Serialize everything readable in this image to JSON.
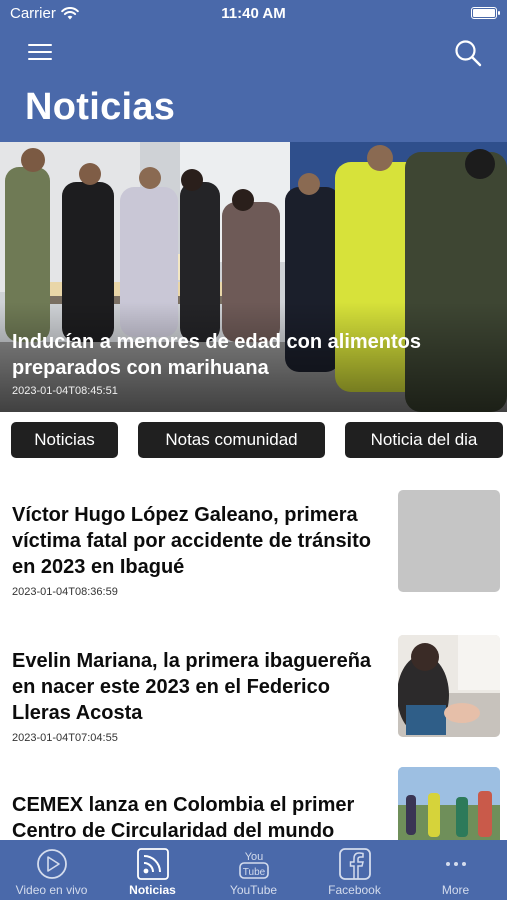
{
  "status_bar": {
    "carrier": "Carrier",
    "time": "11:40 AM"
  },
  "header": {
    "title": "Noticias",
    "menu_icon": "hamburger-menu-icon",
    "search_icon": "search-icon"
  },
  "hero": {
    "title": "Inducían a menores de edad con alimentos preparados con marihuana",
    "date": "2023-01-04T08:45:51"
  },
  "categories": [
    "Noticias",
    "Notas comunidad",
    "Noticia del dia"
  ],
  "articles": [
    {
      "title": "Víctor Hugo López Galeano, primera víctima fatal por accidente de tránsito en 2023 en Ibagué",
      "date": "2023-01-04T08:36:59"
    },
    {
      "title": "Evelin Mariana, la primera ibaguereña en nacer este 2023 en el Federico Lleras Acosta",
      "date": "2023-01-04T07:04:55"
    },
    {
      "title": "CEMEX lanza en Colombia el primer Centro de Circularidad del mundo",
      "date": ""
    }
  ],
  "tabbar": {
    "items": [
      {
        "label": "Video en vivo",
        "icon": "play-circle-icon"
      },
      {
        "label": "Noticias",
        "icon": "rss-feed-icon"
      },
      {
        "label": "YouTube",
        "icon": "youtube-icon"
      },
      {
        "label": "Facebook",
        "icon": "facebook-icon"
      },
      {
        "label": "More",
        "icon": "more-dots-icon"
      }
    ],
    "active": "Noticias"
  },
  "colors": {
    "brand_blue": "#4a69aa",
    "chip_bg": "#202020",
    "text": "#0c0c0c"
  }
}
